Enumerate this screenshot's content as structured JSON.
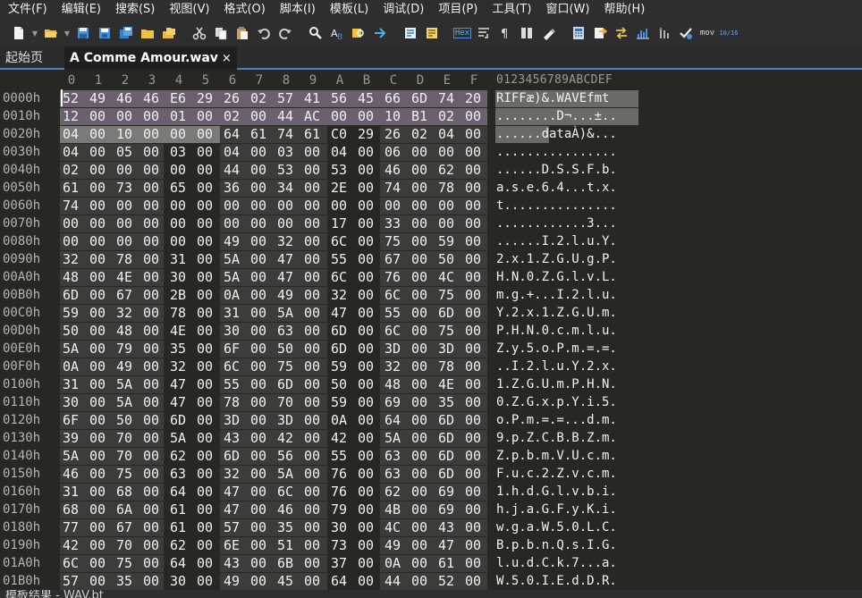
{
  "menu": [
    "文件(F)",
    "编辑(E)",
    "搜索(S)",
    "视图(V)",
    "格式(O)",
    "脚本(I)",
    "模板(L)",
    "调试(D)",
    "项目(P)",
    "工具(T)",
    "窗口(W)",
    "帮助(H)"
  ],
  "toolbar": {
    "icons": [
      "new-file-icon",
      "dropdown",
      "open-folder-icon",
      "dropdown",
      "save-icon",
      "save-as-icon",
      "save-all-icon",
      "folder-icon",
      "open-multiple-icon",
      "sep",
      "cut-icon",
      "copy-icon",
      "paste-icon",
      "undo-icon",
      "redo-icon",
      "sep",
      "find-icon",
      "replace-icon",
      "find-in-files-icon",
      "goto-icon",
      "sep",
      "template-icon",
      "script-icon",
      "sep",
      "hex-icon",
      "line-wrap-icon",
      "paragraph-icon",
      "columns-icon",
      "highlight-icon",
      "sep",
      "calculator-icon",
      "import-icon",
      "swap-icon",
      "histogram-icon",
      "compare-icon",
      "checksum-icon",
      "mov-icon",
      "base-convert-icon"
    ],
    "hex_label": "Hex",
    "mov_label": "mov",
    "base_label": "10/16"
  },
  "tabs": {
    "start": "起始页",
    "active": "A Comme Amour.wav",
    "close": "×"
  },
  "column_headers": [
    "0",
    "1",
    "2",
    "3",
    "4",
    "5",
    "6",
    "7",
    "8",
    "9",
    "A",
    "B",
    "C",
    "D",
    "E",
    "F"
  ],
  "ascii_header": "0123456789ABCDEF",
  "rows": [
    {
      "addr": "0000h",
      "bytes": "52 49 46 46 E6 29 26 02 57 41 56 45 66 6D 74 20",
      "ascii": "RIFFæ)&.WAVEfmt "
    },
    {
      "addr": "0010h",
      "bytes": "12 00 00 00 01 00 02 00 44 AC 00 00 10 B1 02 00",
      "ascii": "........D¬...±.."
    },
    {
      "addr": "0020h",
      "bytes": "04 00 10 00 00 00 64 61 74 61 C0 29 26 02 04 00",
      "ascii": "......dataÀ)&..."
    },
    {
      "addr": "0030h",
      "bytes": "04 00 05 00 03 00 04 00 03 00 04 00 06 00 00 00",
      "ascii": "................"
    },
    {
      "addr": "0040h",
      "bytes": "02 00 00 00 00 00 44 00 53 00 53 00 46 00 62 00",
      "ascii": "......D.S.S.F.b."
    },
    {
      "addr": "0050h",
      "bytes": "61 00 73 00 65 00 36 00 34 00 2E 00 74 00 78 00",
      "ascii": "a.s.e.6.4...t.x."
    },
    {
      "addr": "0060h",
      "bytes": "74 00 00 00 00 00 00 00 00 00 00 00 00 00 00 00",
      "ascii": "t..............."
    },
    {
      "addr": "0070h",
      "bytes": "00 00 00 00 00 00 00 00 00 00 17 00 33 00 00 00",
      "ascii": "............3..."
    },
    {
      "addr": "0080h",
      "bytes": "00 00 00 00 00 00 49 00 32 00 6C 00 75 00 59 00",
      "ascii": "......I.2.l.u.Y."
    },
    {
      "addr": "0090h",
      "bytes": "32 00 78 00 31 00 5A 00 47 00 55 00 67 00 50 00",
      "ascii": "2.x.1.Z.G.U.g.P."
    },
    {
      "addr": "00A0h",
      "bytes": "48 00 4E 00 30 00 5A 00 47 00 6C 00 76 00 4C 00",
      "ascii": "H.N.0.Z.G.l.v.L."
    },
    {
      "addr": "00B0h",
      "bytes": "6D 00 67 00 2B 00 0A 00 49 00 32 00 6C 00 75 00",
      "ascii": "m.g.+...I.2.l.u."
    },
    {
      "addr": "00C0h",
      "bytes": "59 00 32 00 78 00 31 00 5A 00 47 00 55 00 6D 00",
      "ascii": "Y.2.x.1.Z.G.U.m."
    },
    {
      "addr": "00D0h",
      "bytes": "50 00 48 00 4E 00 30 00 63 00 6D 00 6C 00 75 00",
      "ascii": "P.H.N.0.c.m.l.u."
    },
    {
      "addr": "00E0h",
      "bytes": "5A 00 79 00 35 00 6F 00 50 00 6D 00 3D 00 3D 00",
      "ascii": "Z.y.5.o.P.m.=.=."
    },
    {
      "addr": "00F0h",
      "bytes": "0A 00 49 00 32 00 6C 00 75 00 59 00 32 00 78 00",
      "ascii": "..I.2.l.u.Y.2.x."
    },
    {
      "addr": "0100h",
      "bytes": "31 00 5A 00 47 00 55 00 6D 00 50 00 48 00 4E 00",
      "ascii": "1.Z.G.U.m.P.H.N."
    },
    {
      "addr": "0110h",
      "bytes": "30 00 5A 00 47 00 78 00 70 00 59 00 69 00 35 00",
      "ascii": "0.Z.G.x.p.Y.i.5."
    },
    {
      "addr": "0120h",
      "bytes": "6F 00 50 00 6D 00 3D 00 3D 00 0A 00 64 00 6D 00",
      "ascii": "o.P.m.=.=...d.m."
    },
    {
      "addr": "0130h",
      "bytes": "39 00 70 00 5A 00 43 00 42 00 42 00 5A 00 6D 00",
      "ascii": "9.p.Z.C.B.B.Z.m."
    },
    {
      "addr": "0140h",
      "bytes": "5A 00 70 00 62 00 6D 00 56 00 55 00 63 00 6D 00",
      "ascii": "Z.p.b.m.V.U.c.m."
    },
    {
      "addr": "0150h",
      "bytes": "46 00 75 00 63 00 32 00 5A 00 76 00 63 00 6D 00",
      "ascii": "F.u.c.2.Z.v.c.m."
    },
    {
      "addr": "0160h",
      "bytes": "31 00 68 00 64 00 47 00 6C 00 76 00 62 00 69 00",
      "ascii": "1.h.d.G.l.v.b.i."
    },
    {
      "addr": "0170h",
      "bytes": "68 00 6A 00 61 00 47 00 46 00 79 00 4B 00 69 00",
      "ascii": "h.j.a.G.F.y.K.i."
    },
    {
      "addr": "0180h",
      "bytes": "77 00 67 00 61 00 57 00 35 00 30 00 4C 00 43 00",
      "ascii": "w.g.a.W.5.0.L.C."
    },
    {
      "addr": "0190h",
      "bytes": "42 00 70 00 62 00 6E 00 51 00 73 00 49 00 47 00",
      "ascii": "B.p.b.n.Q.s.I.G."
    },
    {
      "addr": "01A0h",
      "bytes": "6C 00 75 00 64 00 43 00 6B 00 37 00 0A 00 61 00",
      "ascii": "l.u.d.C.k.7...a."
    },
    {
      "addr": "01B0h",
      "bytes": "57 00 35 00 30 00 49 00 45 00 64 00 44 00 52 00",
      "ascii": "W.5.0.I.E.d.D.R."
    }
  ],
  "status": "模板结果 - WAV.bt"
}
